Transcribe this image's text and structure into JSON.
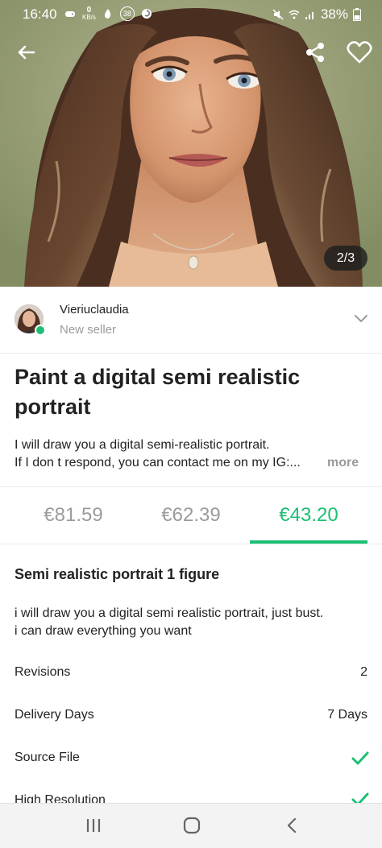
{
  "status_bar": {
    "time": "16:40",
    "data_speed": "0",
    "data_unit": "KB/s",
    "notification_count": "38",
    "battery_percent": "38%"
  },
  "hero": {
    "image_counter": "2/3",
    "back_icon": "arrow-left-icon",
    "share_icon": "share-icon",
    "favorite_icon": "heart-outline-icon"
  },
  "seller": {
    "name": "Vieriuclaudia",
    "level": "New seller",
    "online": true,
    "expand_icon": "chevron-down-icon"
  },
  "gig": {
    "title_line1": "Paint a digital semi realistic",
    "title_line2": "portrait",
    "description_line1": "I will draw you a digital semi-realistic portrait.",
    "description_line2": "If I don t respond, you can contact me on my IG:...",
    "more_label": "more"
  },
  "pricing": {
    "tabs": [
      {
        "label": "€81.59",
        "active": false
      },
      {
        "label": "€62.39",
        "active": false
      },
      {
        "label": "€43.20",
        "active": true
      }
    ]
  },
  "package": {
    "title": "Semi realistic portrait 1 figure",
    "description_line1": "i will draw you a digital semi realistic portrait, just bust.",
    "description_line2": "i can draw everything you want",
    "features": [
      {
        "label": "Revisions",
        "value": "2"
      },
      {
        "label": "Delivery Days",
        "value": "7 Days"
      },
      {
        "label": "Source File",
        "value": "check-icon"
      },
      {
        "label": "High Resolution",
        "value": "check-icon"
      }
    ]
  },
  "colors": {
    "accent_green": "#1dbf73",
    "muted_gray": "#9b9b9b",
    "text_dark": "#222222"
  },
  "nav": {
    "recent_icon": "recent-apps-icon",
    "home_icon": "home-icon",
    "back_icon": "back-chevron-icon"
  }
}
